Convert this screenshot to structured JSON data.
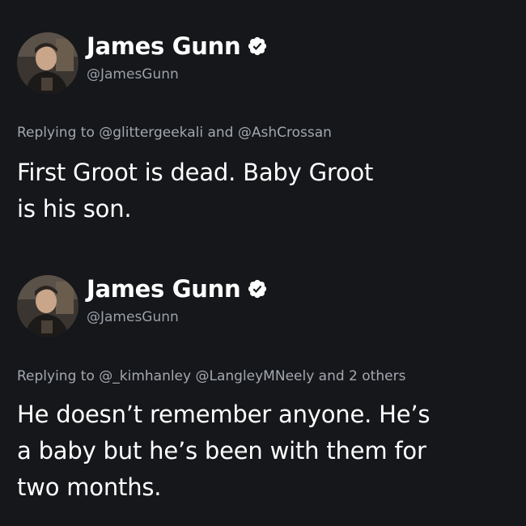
{
  "colors": {
    "background": "#15171b",
    "primary_text": "#ffffff",
    "secondary_text": "#9aa0a8"
  },
  "tweets": [
    {
      "author": {
        "name": "James Gunn",
        "handle": "@JamesGunn",
        "verified_icon": "verified-badge-icon"
      },
      "reply_to": "Replying to @glittergeekali and @AshCrossan",
      "text_lines": [
        "First Groot is dead. Baby Groot",
        "is his son."
      ]
    },
    {
      "author": {
        "name": "James Gunn",
        "handle": "@JamesGunn",
        "verified_icon": "verified-badge-icon"
      },
      "reply_to": "Replying to @_kimhanley @LangleyMNeely and 2 others",
      "text_lines": [
        "He doesn’t remember anyone. He’s",
        "a baby but he’s been with them for",
        "two months."
      ]
    }
  ]
}
